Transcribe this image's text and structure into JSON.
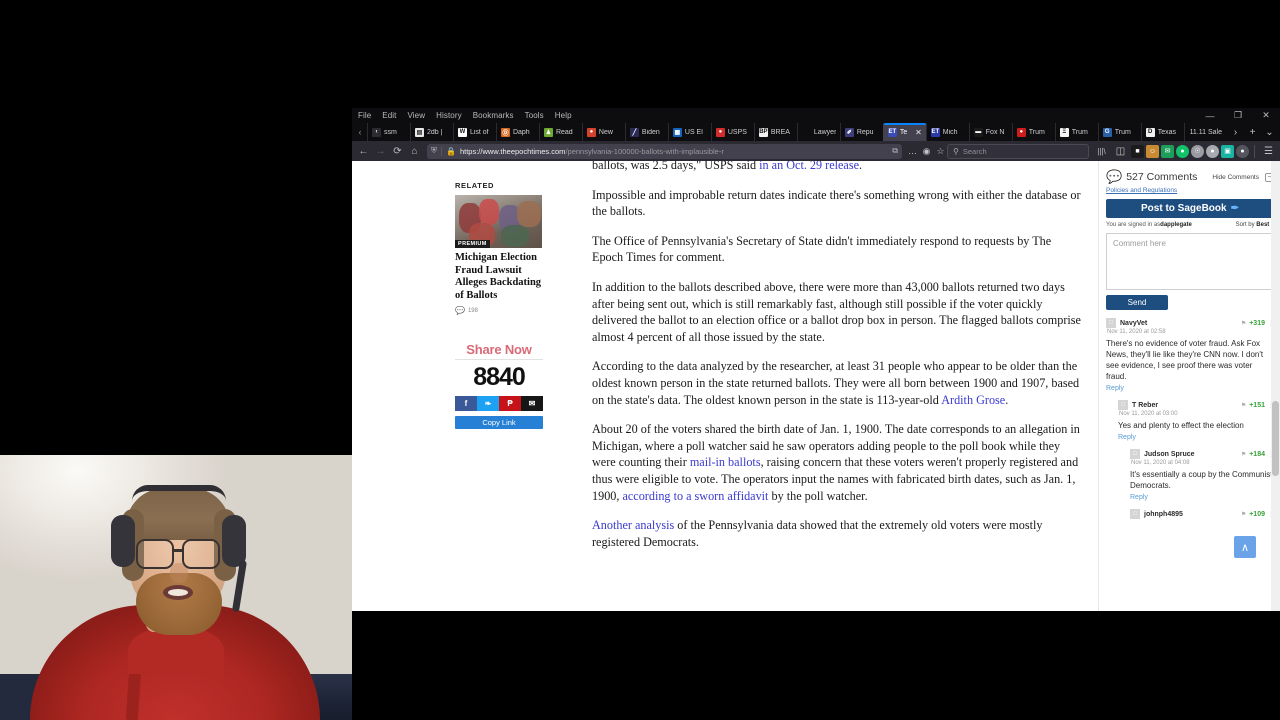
{
  "window": {
    "menubar": [
      "File",
      "Edit",
      "View",
      "History",
      "Bookmarks",
      "Tools",
      "Help"
    ],
    "controls": {
      "minimize": "—",
      "maximize": "❐",
      "close": "✕"
    }
  },
  "tabs": [
    {
      "label": "ssm",
      "fav": "‹",
      "color": "#2b2b30",
      "active": false
    },
    {
      "label": "2db |",
      "fav": "▤",
      "color": "#e8e8e8",
      "fg": "#333",
      "active": false
    },
    {
      "label": "List of",
      "fav": "W",
      "color": "#ffffff",
      "fg": "#111",
      "active": false
    },
    {
      "label": "Daph",
      "fav": "Ⓓ",
      "color": "#d86820",
      "active": false
    },
    {
      "label": "Read",
      "fav": "♟",
      "color": "#6ca832",
      "active": false
    },
    {
      "label": "New",
      "fav": "●",
      "color": "#d5422c",
      "active": false
    },
    {
      "label": "Biden",
      "fav": "╱",
      "color": "#2b2b55",
      "active": false
    },
    {
      "label": "US El",
      "fav": "▦",
      "color": "#1565c0",
      "active": false
    },
    {
      "label": "USPS",
      "fav": "●",
      "color": "#d12b2b",
      "active": false
    },
    {
      "label": "BREA",
      "fav": "BP",
      "color": "#f2f2f2",
      "fg": "#111",
      "active": false
    },
    {
      "label": "Lawyer Sy",
      "fav": "",
      "color": "transparent",
      "active": false
    },
    {
      "label": "Repu",
      "fav": "✐",
      "color": "#3d3d7a",
      "active": false
    },
    {
      "label": "Te",
      "fav": "ET",
      "color": "#3b4bb8",
      "active": true
    },
    {
      "label": "Mich",
      "fav": "ET",
      "color": "#2b3aa8",
      "active": false
    },
    {
      "label": "Fox N",
      "fav": "▬",
      "color": "#1a1a1a",
      "active": false
    },
    {
      "label": "Trum",
      "fav": "●",
      "color": "#cc1c1c",
      "active": false
    },
    {
      "label": "Trum",
      "fav": "Ξ",
      "color": "#f5f5f5",
      "fg": "#111",
      "active": false
    },
    {
      "label": "Trum",
      "fav": "G",
      "color": "#2b5fa8",
      "active": false
    },
    {
      "label": "Texas",
      "fav": "D",
      "color": "#efefef",
      "fg": "#111",
      "active": false
    }
  ],
  "tab_sale_label": "11.11 Sale",
  "tab_strip_controls": {
    "scroll_left": "‹",
    "scroll_right": "›",
    "new_tab": "+",
    "list_all": "⌄"
  },
  "nav": {
    "back": "←",
    "forward": "→",
    "reload": "⟳",
    "home": "⌂",
    "shield": "⛨",
    "lock": "🔒",
    "url_visible": "https://www.theepochtimes.com",
    "url_path": "/pennsylvania-100000-ballots-with-implausible-r",
    "reader_icon": "⧉",
    "more_icon": "…",
    "pocket_icon": "◉",
    "star_icon": "☆",
    "search_placeholder": "Search",
    "search_icon": "⚲",
    "library_icon": "|||\\",
    "sidebar_icon": "◫",
    "extension_icons": [
      "■",
      "☺",
      "✉",
      "●",
      "⊕",
      "●",
      "▣",
      "○"
    ],
    "menu_icon": "☰"
  },
  "related": {
    "section_label": "RELATED",
    "badge": "PREMIUM",
    "title": "Michigan Election Fraud Lawsuit Alleges Backdating of Ballots",
    "comment_icon": "💬",
    "comment_count": "198"
  },
  "share": {
    "heading": "Share Now",
    "count": "8840",
    "buttons": [
      {
        "name": "facebook",
        "glyph": "f"
      },
      {
        "name": "twitter",
        "glyph": "❧"
      },
      {
        "name": "parler",
        "glyph": "₱"
      },
      {
        "name": "email",
        "glyph": "✉"
      }
    ],
    "copy_link": "Copy Link"
  },
  "article": {
    "paragraphs": [
      {
        "parts": [
          {
            "t": "ballots, was 2.5 days,\" USPS said "
          },
          {
            "t": "in an Oct. 29 release",
            "link": true
          },
          {
            "t": "."
          }
        ]
      },
      {
        "parts": [
          {
            "t": "Impossible and improbable return dates indicate there's something wrong with either the database or the ballots."
          }
        ]
      },
      {
        "parts": [
          {
            "t": "The Office of Pennsylvania's Secretary of State didn't immediately respond to requests by The Epoch Times for comment."
          }
        ]
      },
      {
        "parts": [
          {
            "t": "In addition to the ballots described above, there were more than 43,000 ballots returned two days after being sent out, which is still remarkably fast, although still possible if the voter quickly delivered the ballot to an election office or a ballot drop box in person. The flagged ballots comprise almost 4 percent of all those issued by the state."
          }
        ]
      },
      {
        "parts": [
          {
            "t": "According to the data analyzed by the researcher, at least 31 people who appear to be older than the oldest known person in the state returned ballots. They were all born between 1900 and 1907, based on the state's data. The oldest known person in the state is 113-year-old "
          },
          {
            "t": "Ardith Grose",
            "link": true
          },
          {
            "t": "."
          }
        ]
      },
      {
        "parts": [
          {
            "t": "About 20 of the voters shared the birth date of Jan. 1, 1900. The date corresponds to an allegation in Michigan, where a poll watcher said he saw operators adding people to the poll book while they were counting their "
          },
          {
            "t": "mail-in ballots",
            "link": true
          },
          {
            "t": ", raising concern that these voters weren't properly registered and thus were eligible to vote. The operators input the names with fabricated birth dates, such as Jan. 1, 1900, "
          },
          {
            "t": "according to a sworn affidavit",
            "link": true
          },
          {
            "t": " by the poll watcher."
          }
        ]
      },
      {
        "parts": [
          {
            "t": "Another analysis",
            "link": true
          },
          {
            "t": " of the Pennsylvania data showed that the extremely old voters were mostly registered Democrats."
          }
        ]
      }
    ]
  },
  "comments_panel": {
    "bubble_icon": "💬",
    "count_label": "527 Comments",
    "hide_label": "Hide Comments",
    "collapse_glyph": "−",
    "policies_link": "Policies and Regulations",
    "post_button": "Post to SageBook",
    "post_button_icon": "✒",
    "signed_in_prefix": "You are signed in as ",
    "signed_in_user": "dapplegate",
    "sort_prefix": "Sort by ",
    "sort_value": "Best",
    "sort_caret": "▾",
    "comment_placeholder": "Comment here",
    "send_button": "Send",
    "reply_label": "Reply",
    "flag_icon": "⚑",
    "dots_icon": "⋮",
    "comments": [
      {
        "level": 0,
        "user": "NavyVet",
        "date": "Nov 11, 2020 at 02:58",
        "score": "+319",
        "text": "There's no evidence of voter fraud. Ask Fox News, they'll lie like they're CNN now. I don't see evidence, I see proof there was voter fraud.",
        "reply": "Reply"
      },
      {
        "level": 1,
        "user": "T Reber",
        "date": "Nov 11, 2020 at 03:00",
        "score": "+151",
        "text": "Yes and plenty to effect the election",
        "reply": "Reply"
      },
      {
        "level": 2,
        "user": "Judson Spruce",
        "date": "Nov 11, 2020 at 04:08",
        "score": "+184",
        "text": "It's essentially a coup by the Communist Democrats.",
        "reply": "Reply"
      },
      {
        "level": 2,
        "user": "johnph4895",
        "date": "",
        "score": "+109",
        "text": "",
        "reply": ""
      }
    ]
  },
  "go_top_button": {
    "icon": "∧",
    "label": "Go to top"
  },
  "colors": {
    "accent_blue": "#1e4d80",
    "link_blue": "#3a3ad1",
    "score_green": "#3aa23a",
    "share_pink": "#d96a77",
    "copy_blue": "#2680d6",
    "tab_active": "#42414d"
  }
}
